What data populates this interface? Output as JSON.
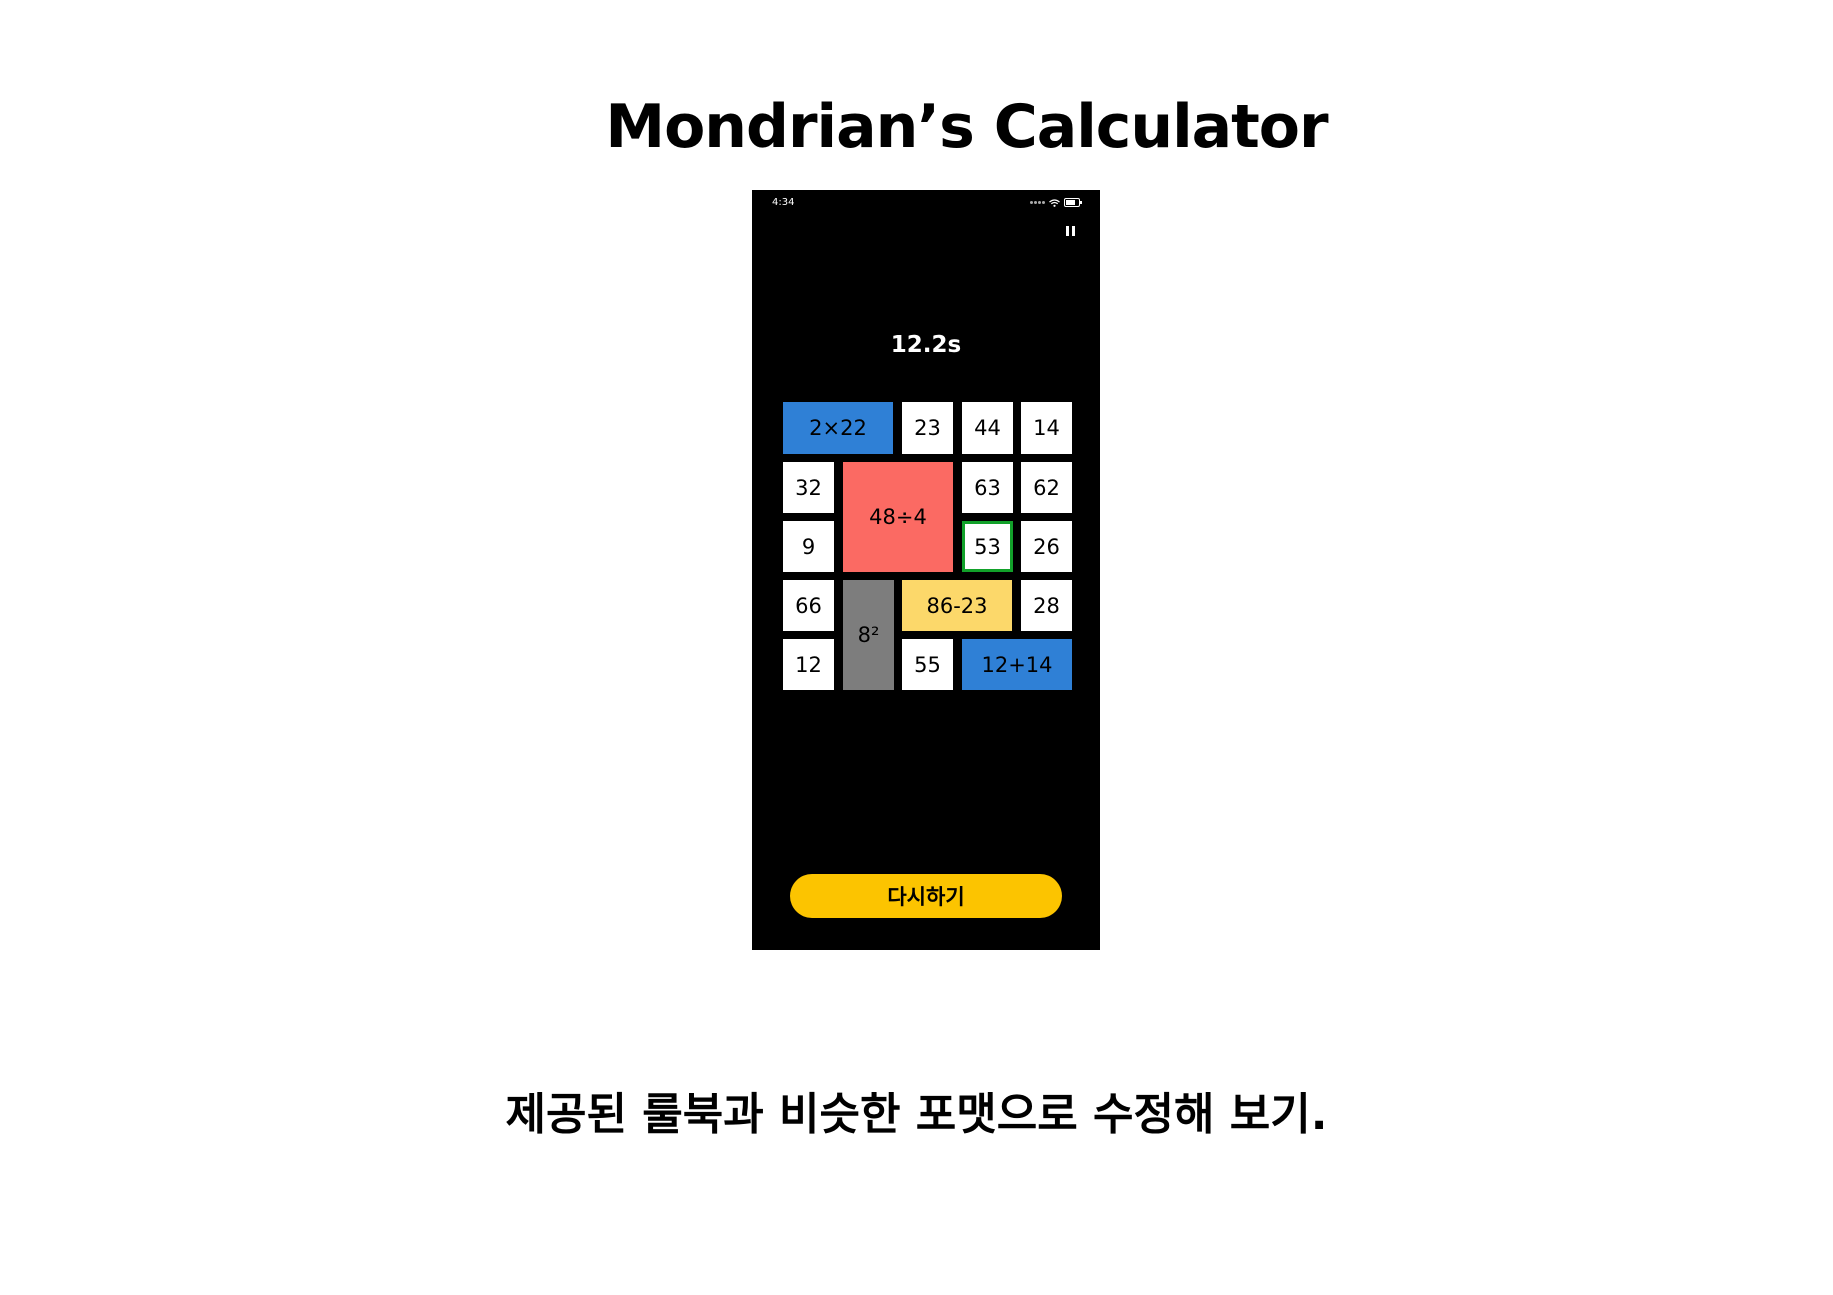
{
  "page": {
    "title": "Mondrian’s Calculator",
    "instruction": "제공된 룰북과 비슷한 포맷으로 수정해 보기."
  },
  "phone": {
    "status_time": "4:34",
    "status_icons": [
      "signal-icon",
      "wifi-icon",
      "battery-icon"
    ],
    "pause_icon": "pause-icon",
    "timer": "12.2s",
    "retry_label": "다시하기",
    "accent_color": "#fcc400"
  },
  "tiles": [
    {
      "label": "2×22",
      "color": "blue"
    },
    {
      "label": "23",
      "color": "white"
    },
    {
      "label": "44",
      "color": "white"
    },
    {
      "label": "14",
      "color": "white"
    },
    {
      "label": "32",
      "color": "white"
    },
    {
      "label": "48÷4",
      "color": "red"
    },
    {
      "label": "63",
      "color": "white"
    },
    {
      "label": "62",
      "color": "white"
    },
    {
      "label": "9",
      "color": "white"
    },
    {
      "label": "53",
      "color": "white",
      "selected": true
    },
    {
      "label": "26",
      "color": "white"
    },
    {
      "label": "66",
      "color": "white"
    },
    {
      "label": "8²",
      "color": "gray"
    },
    {
      "label": "86-23",
      "color": "yellow"
    },
    {
      "label": "28",
      "color": "white"
    },
    {
      "label": "12",
      "color": "white"
    },
    {
      "label": "55",
      "color": "white"
    },
    {
      "label": "12+14",
      "color": "blue"
    }
  ],
  "colors": {
    "blue": "#2f80d6",
    "red": "#fb6a63",
    "yellow": "#fcd86a",
    "gray": "#7d7d7d",
    "selected_border": "#12a12a"
  }
}
